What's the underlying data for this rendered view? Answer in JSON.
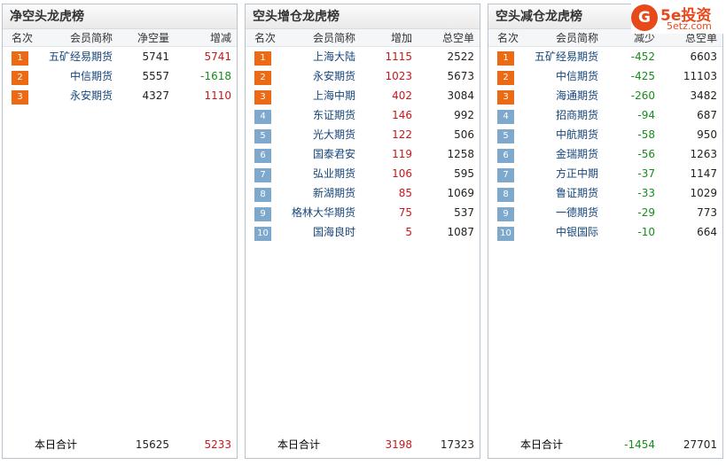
{
  "logo": {
    "icon_text": "G",
    "main": "5e投资",
    "sub": "5etz.com"
  },
  "panels": [
    {
      "title": "净空头龙虎榜",
      "headers": [
        "名次",
        "会员简称",
        "净空量",
        "增减"
      ],
      "rows": [
        {
          "rank": "1",
          "name": "五矿经易期货",
          "v1": "5741",
          "v2": "5741"
        },
        {
          "rank": "2",
          "name": "中信期货",
          "v1": "5557",
          "v2": "-1618"
        },
        {
          "rank": "3",
          "name": "永安期货",
          "v1": "4327",
          "v2": "1110"
        }
      ],
      "total": {
        "label": "本日合计",
        "v1": "15625",
        "v2": "5233"
      }
    },
    {
      "title": "空头增仓龙虎榜",
      "headers": [
        "名次",
        "会员简称",
        "增加",
        "总空单"
      ],
      "rows": [
        {
          "rank": "1",
          "name": "上海大陆",
          "v1": "1115",
          "v2": "2522"
        },
        {
          "rank": "2",
          "name": "永安期货",
          "v1": "1023",
          "v2": "5673"
        },
        {
          "rank": "3",
          "name": "上海中期",
          "v1": "402",
          "v2": "3084"
        },
        {
          "rank": "4",
          "name": "东证期货",
          "v1": "146",
          "v2": "992"
        },
        {
          "rank": "5",
          "name": "光大期货",
          "v1": "122",
          "v2": "506"
        },
        {
          "rank": "6",
          "name": "国泰君安",
          "v1": "119",
          "v2": "1258"
        },
        {
          "rank": "7",
          "name": "弘业期货",
          "v1": "106",
          "v2": "595"
        },
        {
          "rank": "8",
          "name": "新湖期货",
          "v1": "85",
          "v2": "1069"
        },
        {
          "rank": "9",
          "name": "格林大华期货",
          "v1": "75",
          "v2": "537"
        },
        {
          "rank": "10",
          "name": "国海良时",
          "v1": "5",
          "v2": "1087"
        }
      ],
      "total": {
        "label": "本日合计",
        "v1": "3198",
        "v2": "17323"
      }
    },
    {
      "title": "空头减仓龙虎榜",
      "headers": [
        "名次",
        "会员简称",
        "减少",
        "总空单"
      ],
      "rows": [
        {
          "rank": "1",
          "name": "五矿经易期货",
          "v1": "-452",
          "v2": "6603"
        },
        {
          "rank": "2",
          "name": "中信期货",
          "v1": "-425",
          "v2": "11103"
        },
        {
          "rank": "3",
          "name": "海通期货",
          "v1": "-260",
          "v2": "3482"
        },
        {
          "rank": "4",
          "name": "招商期货",
          "v1": "-94",
          "v2": "687"
        },
        {
          "rank": "5",
          "name": "中航期货",
          "v1": "-58",
          "v2": "950"
        },
        {
          "rank": "6",
          "name": "金瑞期货",
          "v1": "-56",
          "v2": "1263"
        },
        {
          "rank": "7",
          "name": "方正中期",
          "v1": "-37",
          "v2": "1147"
        },
        {
          "rank": "8",
          "name": "鲁证期货",
          "v1": "-33",
          "v2": "1029"
        },
        {
          "rank": "9",
          "name": "一德期货",
          "v1": "-29",
          "v2": "773"
        },
        {
          "rank": "10",
          "name": "中银国际",
          "v1": "-10",
          "v2": "664"
        }
      ],
      "total": {
        "label": "本日合计",
        "v1": "-1454",
        "v2": "27701"
      }
    }
  ],
  "colors": {
    "rank_top3": "#ec6a14",
    "rank_other": "#7fa9cc",
    "positive": "#c6171d",
    "negative": "#168c1c",
    "name": "#16457a",
    "brand": "#e8491a"
  }
}
